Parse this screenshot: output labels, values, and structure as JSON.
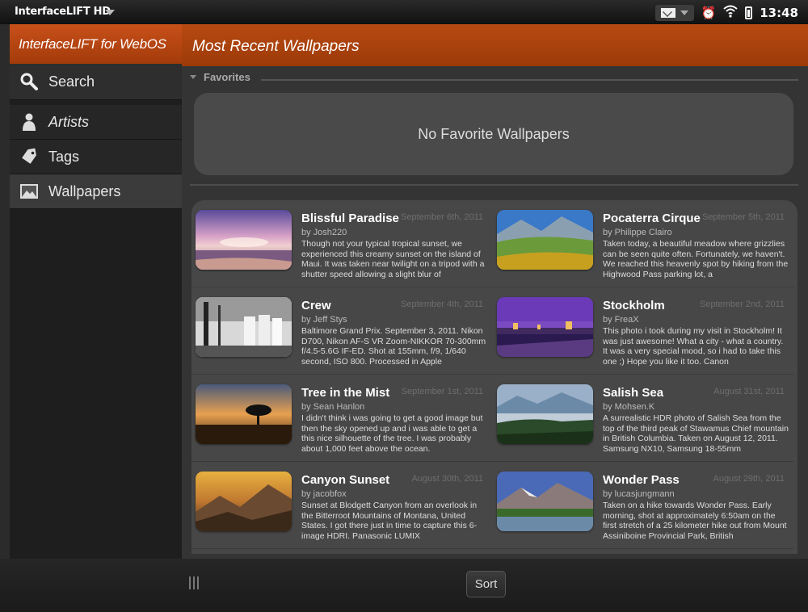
{
  "status_bar": {
    "app_name": "InterfaceLIFT HD",
    "time": "13:48",
    "icons": [
      "mail-icon",
      "alarm-icon",
      "wifi-icon",
      "battery-icon"
    ]
  },
  "sidebar": {
    "title": "InterfaceLIFT for WebOS",
    "items": [
      {
        "label": "Search",
        "icon": "search-icon"
      },
      {
        "label": "Artists",
        "icon": "person-icon"
      },
      {
        "label": "Tags",
        "icon": "tag-icon"
      },
      {
        "label": "Wallpapers",
        "icon": "image-icon",
        "selected": true
      }
    ]
  },
  "main": {
    "title": "Most Recent Wallpapers",
    "favorites_label": "Favorites",
    "favorites_empty": "No Favorite Wallpapers",
    "wallpapers": [
      {
        "title": "Blissful Paradise",
        "date": "September 6th, 2011",
        "author": "by Josh220",
        "description": "Though not your typical tropical sunset, we experienced this creamy sunset on the island of Maui. It was taken near twilight on a tripod with a shutter speed allowing a slight blur of"
      },
      {
        "title": "Pocaterra Cirque",
        "date": "September 5th, 2011",
        "author": "by Philippe Clairo",
        "description": "Taken today, a beautiful meadow where grizzlies can be seen quite often. Fortunately, we haven't. We reached this heavenly spot by hiking from the Highwood Pass parking lot, a"
      },
      {
        "title": "Crew",
        "date": "September 4th, 2011",
        "author": "by Jeff Stys",
        "description": "Baltimore Grand Prix. September 3, 2011. Nikon D700, Nikon AF-S VR Zoom-NIKKOR 70-300mm f/4.5-5.6G IF-ED. Shot at 155mm, f/9, 1/640 second, ISO 800. Processed in Apple"
      },
      {
        "title": "Stockholm",
        "date": "September 2nd, 2011",
        "author": "by FreaX",
        "description": "This photo i took during my visit in Stockholm! It was just awesome! What a city - what a country. It was a very special mood, so i had to take this one ;) Hope you like it too. Canon"
      },
      {
        "title": "Tree in the Mist",
        "date": "September 1st, 2011",
        "author": "by Sean Hanlon",
        "description": "I didn't think i was going to get a good image but then the sky opened up and i was able to get a this nice silhouette of the tree. I was probably about 1,000 feet above the ocean."
      },
      {
        "title": "Salish Sea",
        "date": "August 31st, 2011",
        "author": "by Mohsen.K",
        "description": "A surrealistic HDR photo of Salish Sea from the top of the third peak of Stawamus Chief mountain in British Columbia. Taken on August 12, 2011. Samsung NX10, Samsung 18-55mm"
      },
      {
        "title": "Canyon Sunset",
        "date": "August 30th, 2011",
        "author": "by jacobfox",
        "description": "Sunset at Blodgett Canyon from an overlook in the Bitterroot Mountains of Montana, United States. I got there just in time to capture this 6-image HDRI. Panasonic LUMIX"
      },
      {
        "title": "Wonder Pass",
        "date": "August 29th, 2011",
        "author": "by lucasjungmann",
        "description": "Taken on a hike towards Wonder Pass. Early morning, shot at approximately 6:50am on the first stretch of a 25 kilometer hike out from Mount Assiniboine Provincial Park, British"
      }
    ]
  },
  "bottom_bar": {
    "sort_label": "Sort"
  },
  "colors": {
    "accent": "#b84a12",
    "background": "#343434"
  }
}
